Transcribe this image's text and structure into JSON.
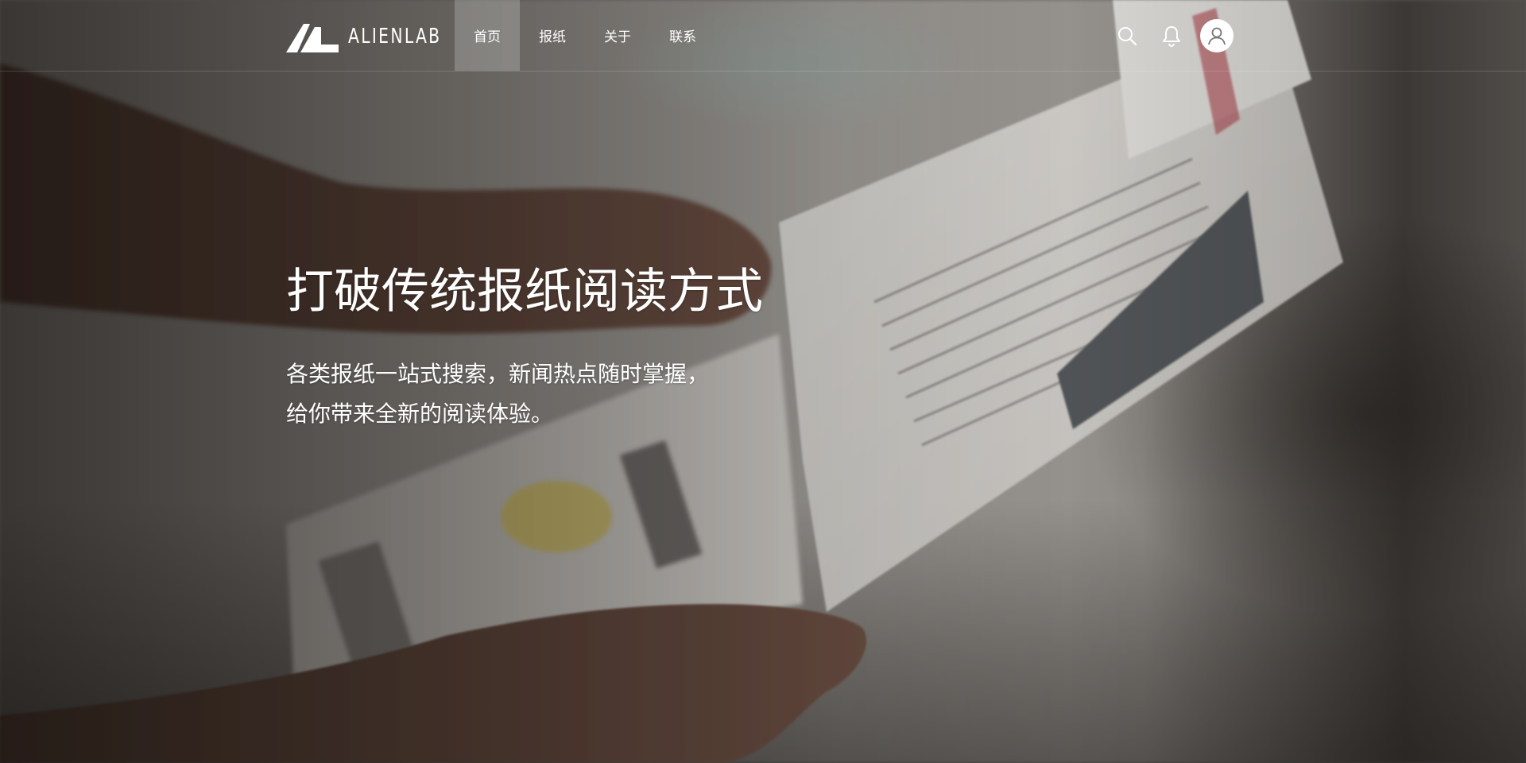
{
  "brand": {
    "name": "ALIENLAB"
  },
  "nav": {
    "items": [
      {
        "label": "首页",
        "active": true
      },
      {
        "label": "报纸",
        "active": false
      },
      {
        "label": "关于",
        "active": false
      },
      {
        "label": "联系",
        "active": false
      }
    ],
    "icons": [
      "search-icon",
      "bell-icon",
      "user-icon"
    ]
  },
  "hero": {
    "title": "打破传统报纸阅读方式",
    "subtitle_line1": "各类报纸一站式搜索，新闻热点随时掌握，",
    "subtitle_line2": "给你带来全新的阅读体验。"
  },
  "colors": {
    "text": "#ffffff",
    "active_nav_bg": "rgba(255,255,255,0.2)"
  }
}
